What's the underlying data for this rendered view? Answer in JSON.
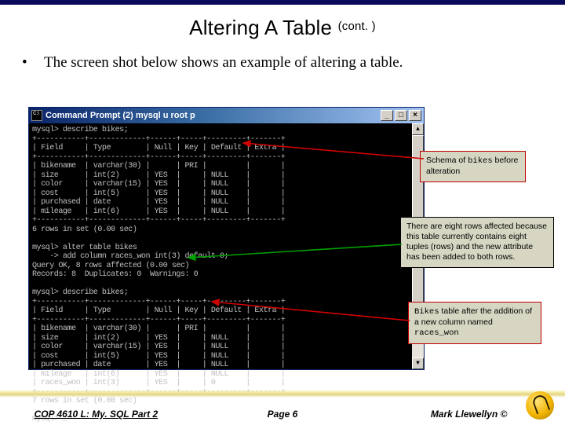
{
  "slide": {
    "title_main": "Altering A Table",
    "title_cont": "(cont. )",
    "bullet": "The screen shot below shows an example of altering a table."
  },
  "window": {
    "title": "Command Prompt (2)   mysql  u root  p",
    "buttons": {
      "min": "_",
      "max": "□",
      "close": "×"
    }
  },
  "terminal": {
    "line01": "mysql> describe bikes;",
    "line02": "+-----------+-------------+------+-----+---------+-------+",
    "line03": "| Field     | Type        | Null | Key | Default | Extra |",
    "line04": "+-----------+-------------+------+-----+---------+-------+",
    "line05": "| bikename  | varchar(30) |      | PRI |         |       |",
    "line06": "| size      | int(2)      | YES  |     | NULL    |       |",
    "line07": "| color     | varchar(15) | YES  |     | NULL    |       |",
    "line08": "| cost      | int(5)      | YES  |     | NULL    |       |",
    "line09": "| purchased | date        | YES  |     | NULL    |       |",
    "line10": "| mileage   | int(6)      | YES  |     | NULL    |       |",
    "line11": "+-----------+-------------+------+-----+---------+-------+",
    "line12": "6 rows in set (0.00 sec)",
    "line13": "",
    "line14": "mysql> alter table bikes",
    "line15": "    -> add column races_won int(3) default 0;",
    "line16": "Query OK, 8 rows affected (0.00 sec)",
    "line17": "Records: 8  Duplicates: 0  Warnings: 0",
    "line18": "",
    "line19": "mysql> describe bikes;",
    "line20": "+-----------+-------------+------+-----+---------+-------+",
    "line21": "| Field     | Type        | Null | Key | Default | Extra |",
    "line22": "+-----------+-------------+------+-----+---------+-------+",
    "line23": "| bikename  | varchar(30) |      | PRI |         |       |",
    "line24": "| size      | int(2)      | YES  |     | NULL    |       |",
    "line25": "| color     | varchar(15) | YES  |     | NULL    |       |",
    "line26": "| cost      | int(5)      | YES  |     | NULL    |       |",
    "line27": "| purchased | date        | YES  |     | NULL    |       |",
    "line28": "| mileage   | int(6)      | YES  |     | NULL    |       |",
    "line29": "| races_won | int(3)      | YES  |     | 0       |       |",
    "line30": "+-----------+-------------+------+-----+---------+-------+",
    "line31": "7 rows in set (0.00 sec)",
    "line32": "",
    "line33": "mysql> _"
  },
  "callouts": {
    "c1_pre": "Schema of ",
    "c1_mono": "bikes",
    "c1_post": " before alteration",
    "c2": "There are eight rows affected because this table currently contains eight tuples (rows) and the new attribute has been added to both rows.",
    "c3_mono1": "Bikes",
    "c3_a": " table after the addition of a new column named ",
    "c3_mono2": "races_won"
  },
  "footer": {
    "left": "COP 4610 L: My. SQL Part 2",
    "mid": "Page 6",
    "right": "Mark Llewellyn ©"
  }
}
